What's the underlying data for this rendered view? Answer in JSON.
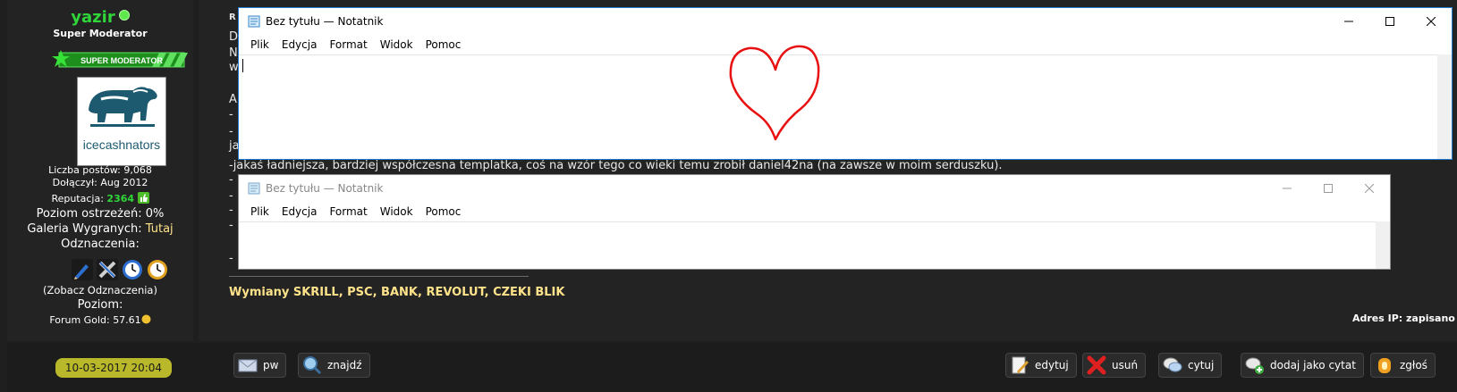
{
  "user": {
    "name": "yazir",
    "title": "Super Moderator",
    "rank_badge_text": "SUPER MODERATOR",
    "avatar_text": "icecashnators",
    "posts_label": "Liczba postów:",
    "posts_value": "9,068",
    "joined_label": "Dołączył:",
    "joined_value": "Aug 2012",
    "rep_label": "Reputacja:",
    "rep_value": "2364",
    "warn_label": "Poziom ostrzeżeń:",
    "warn_value": "0%",
    "gallery_label": "Galeria Wygranych:",
    "gallery_value": "Tutaj",
    "badges_label": "Odznaczenia:",
    "badges_link": "(Zobacz Odznaczenia)",
    "level_label": "Poziom:",
    "gold_label": "Forum Gold:",
    "gold_value": "57.61"
  },
  "post": {
    "date": "10-03-2017 20:04",
    "visible_line": "-jakaś ładniejsza, bardziej współczesna templatka, coś na wzór tego co wieki temu zrobił daniel42na (na zawsze w moim serduszku).",
    "fragments": [
      "R",
      "D",
      "N",
      "w",
      "A",
      "-",
      "-",
      "ja",
      "-",
      "-",
      "-",
      "-",
      "-"
    ],
    "signature": "Wymiany SKRILL, PSC, BANK, REVOLUT, CZEKI BLIK",
    "ip_text": "Adres IP: zapisano"
  },
  "buttons": {
    "pm": "pw",
    "find": "znajdź",
    "edit": "edytuj",
    "delete": "usuń",
    "quote": "cytuj",
    "multiquote": "dodaj jako cytat",
    "report": "zgłoś"
  },
  "notepad_front": {
    "title": "Bez tytułu — Notatnik",
    "menu": [
      "Plik",
      "Edycja",
      "Format",
      "Widok",
      "Pomoc"
    ]
  },
  "notepad_back": {
    "title": "Bez tytułu — Notatnik",
    "menu": [
      "Plik",
      "Edycja",
      "Format",
      "Widok",
      "Pomoc"
    ]
  },
  "colors": {
    "username": "#2fd63a",
    "heart": "#e81010",
    "date_highlight": "#b8b82a",
    "signature": "#ffe38a"
  }
}
